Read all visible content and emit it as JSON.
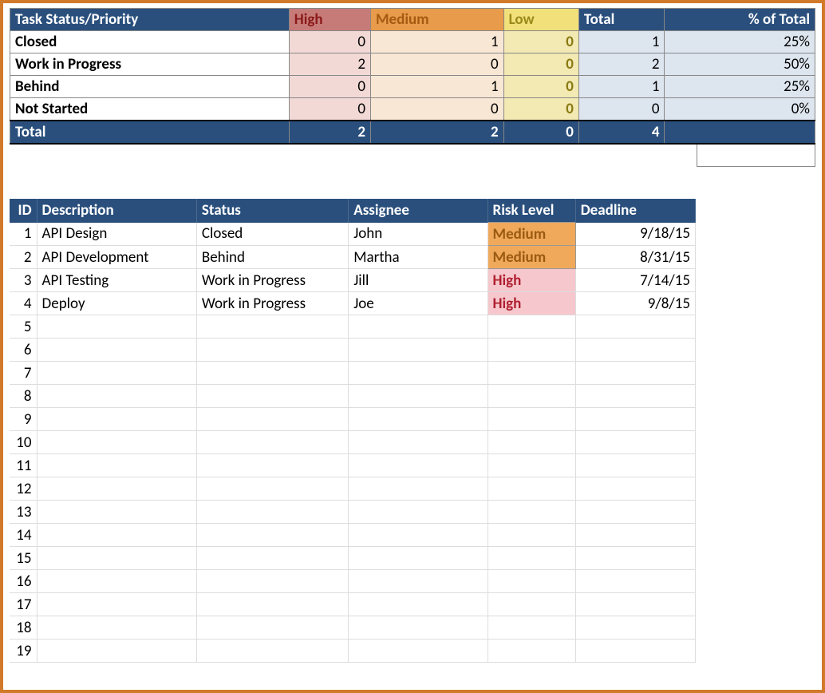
{
  "summary": {
    "header": {
      "title": "Task Status/Priority",
      "high": "High",
      "medium": "Medium",
      "low": "Low",
      "total": "Total",
      "pct": "% of Total"
    },
    "rows": [
      {
        "label": "Closed",
        "high": "0",
        "medium": "1",
        "low": "0",
        "total": "1",
        "pct": "25%"
      },
      {
        "label": "Work in Progress",
        "high": "2",
        "medium": "0",
        "low": "0",
        "total": "2",
        "pct": "50%"
      },
      {
        "label": "Behind",
        "high": "0",
        "medium": "1",
        "low": "0",
        "total": "1",
        "pct": "25%"
      },
      {
        "label": "Not Started",
        "high": "0",
        "medium": "0",
        "low": "0",
        "total": "0",
        "pct": "0%"
      }
    ],
    "totalrow": {
      "label": "Total",
      "high": "2",
      "medium": "2",
      "low": "0",
      "total": "4",
      "pct": ""
    }
  },
  "tasks": {
    "header": {
      "id": "ID",
      "description": "Description",
      "status": "Status",
      "assignee": "Assignee",
      "risk": "Risk Level",
      "deadline": "Deadline"
    },
    "rows": [
      {
        "id": "1",
        "description": "API Design",
        "status": "Closed",
        "assignee": "John",
        "risk": "Medium",
        "risk_class": "risk-medium",
        "deadline": "9/18/15"
      },
      {
        "id": "2",
        "description": "API Development",
        "status": "Behind",
        "assignee": "Martha",
        "risk": "Medium",
        "risk_class": "risk-medium",
        "deadline": "8/31/15"
      },
      {
        "id": "3",
        "description": "API Testing",
        "status": "Work in Progress",
        "assignee": "Jill",
        "risk": "High",
        "risk_class": "risk-high",
        "deadline": "7/14/15"
      },
      {
        "id": "4",
        "description": "Deploy",
        "status": "Work in Progress",
        "assignee": "Joe",
        "risk": "High",
        "risk_class": "risk-high",
        "deadline": "9/8/15"
      }
    ],
    "empty_ids": [
      "5",
      "6",
      "7",
      "8",
      "9",
      "10",
      "11",
      "12",
      "13",
      "14",
      "15",
      "16",
      "17",
      "18",
      "19"
    ]
  }
}
